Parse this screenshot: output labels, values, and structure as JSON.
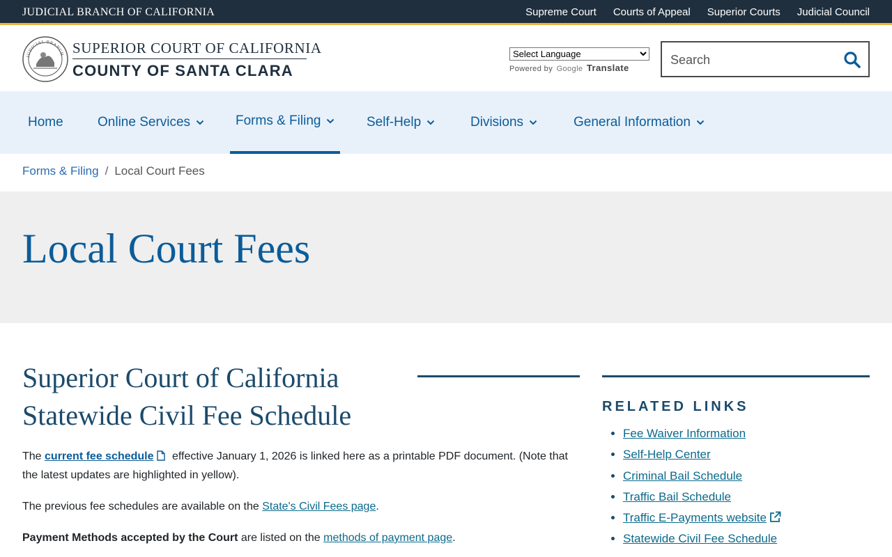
{
  "topbar": {
    "brand": "JUDICIAL BRANCH OF CALIFORNIA",
    "links": [
      "Supreme Court",
      "Courts of Appeal",
      "Superior Courts",
      "Judicial Council"
    ]
  },
  "header": {
    "court_line1": "SUPERIOR COURT OF CALIFORNIA",
    "court_line2": "COUNTY OF SANTA CLARA",
    "seal_text": "JUDICIAL BRANCH OF CALIFORNIA",
    "translate": {
      "select_label": "Select Language",
      "powered_by": "Powered by",
      "google": "Google",
      "translate": "Translate"
    },
    "search": {
      "placeholder": "Search"
    }
  },
  "nav": {
    "items": [
      {
        "label": "Home",
        "has_menu": false
      },
      {
        "label": "Online Services",
        "has_menu": true
      },
      {
        "label": "Forms & Filing",
        "has_menu": true,
        "active": true
      },
      {
        "label": "Self-Help",
        "has_menu": true
      },
      {
        "label": "Divisions",
        "has_menu": true
      },
      {
        "label": "General Information",
        "has_menu": true
      }
    ]
  },
  "breadcrumb": {
    "parent": "Forms & Filing",
    "separator": "/",
    "current": "Local Court Fees"
  },
  "page": {
    "title": "Local Court Fees",
    "section_title": "Superior Court of California Statewide Civil Fee Schedule",
    "p1": {
      "pre": "The ",
      "link": "current fee schedule",
      "post": " effective January 1, 2026 is linked here as a printable PDF document. (Note that the latest updates are highlighted in yellow)."
    },
    "p2": {
      "pre": "The previous fee schedules are available on the ",
      "link": "State's Civil Fees page",
      "post": "."
    },
    "p3": {
      "strong": "Payment Methods accepted by the Court",
      "pre": " are listed on the ",
      "link": "methods of payment page",
      "post": "."
    }
  },
  "sidebar": {
    "heading": "RELATED LINKS",
    "links": [
      {
        "label": "Fee Waiver Information",
        "external": false
      },
      {
        "label": "Self-Help Center",
        "external": false
      },
      {
        "label": "Criminal Bail Schedule",
        "external": false
      },
      {
        "label": "Traffic Bail Schedule",
        "external": false
      },
      {
        "label": "Traffic E-Payments website",
        "external": true
      },
      {
        "label": "Statewide Civil Fee Schedule",
        "external": false
      }
    ]
  },
  "colors": {
    "topbar_bg": "#1f2f3e",
    "topbar_accent": "#f0b43a",
    "brand_blue": "#0b5c99",
    "nav_bg": "#e8f1fa",
    "title_band_bg": "#efefef",
    "heading_navy": "#1b4a6b"
  },
  "icons": {
    "search": "search-icon",
    "chevron": "chevron-down-icon",
    "pdf": "pdf-file-icon",
    "external": "external-link-icon"
  }
}
